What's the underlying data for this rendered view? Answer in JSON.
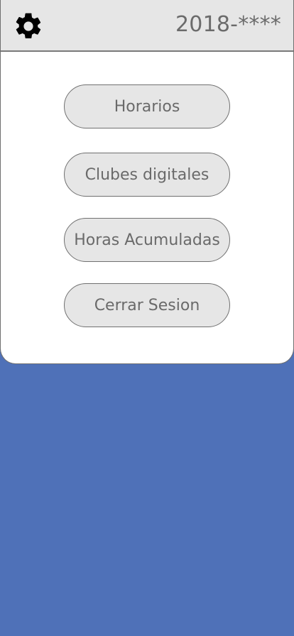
{
  "header": {
    "user_code": "2018-****",
    "settings_icon": "gear-icon"
  },
  "menu": {
    "items": [
      {
        "label": "Horarios"
      },
      {
        "label": "Clubes digitales"
      },
      {
        "label": "Horas Acumuladas"
      },
      {
        "label": "Cerrar Sesion"
      }
    ]
  },
  "colors": {
    "background": "#4f71b8",
    "panel": "#ffffff",
    "header": "#e6e6e6",
    "button": "#e6e6e6",
    "text": "#6a6a6a"
  }
}
